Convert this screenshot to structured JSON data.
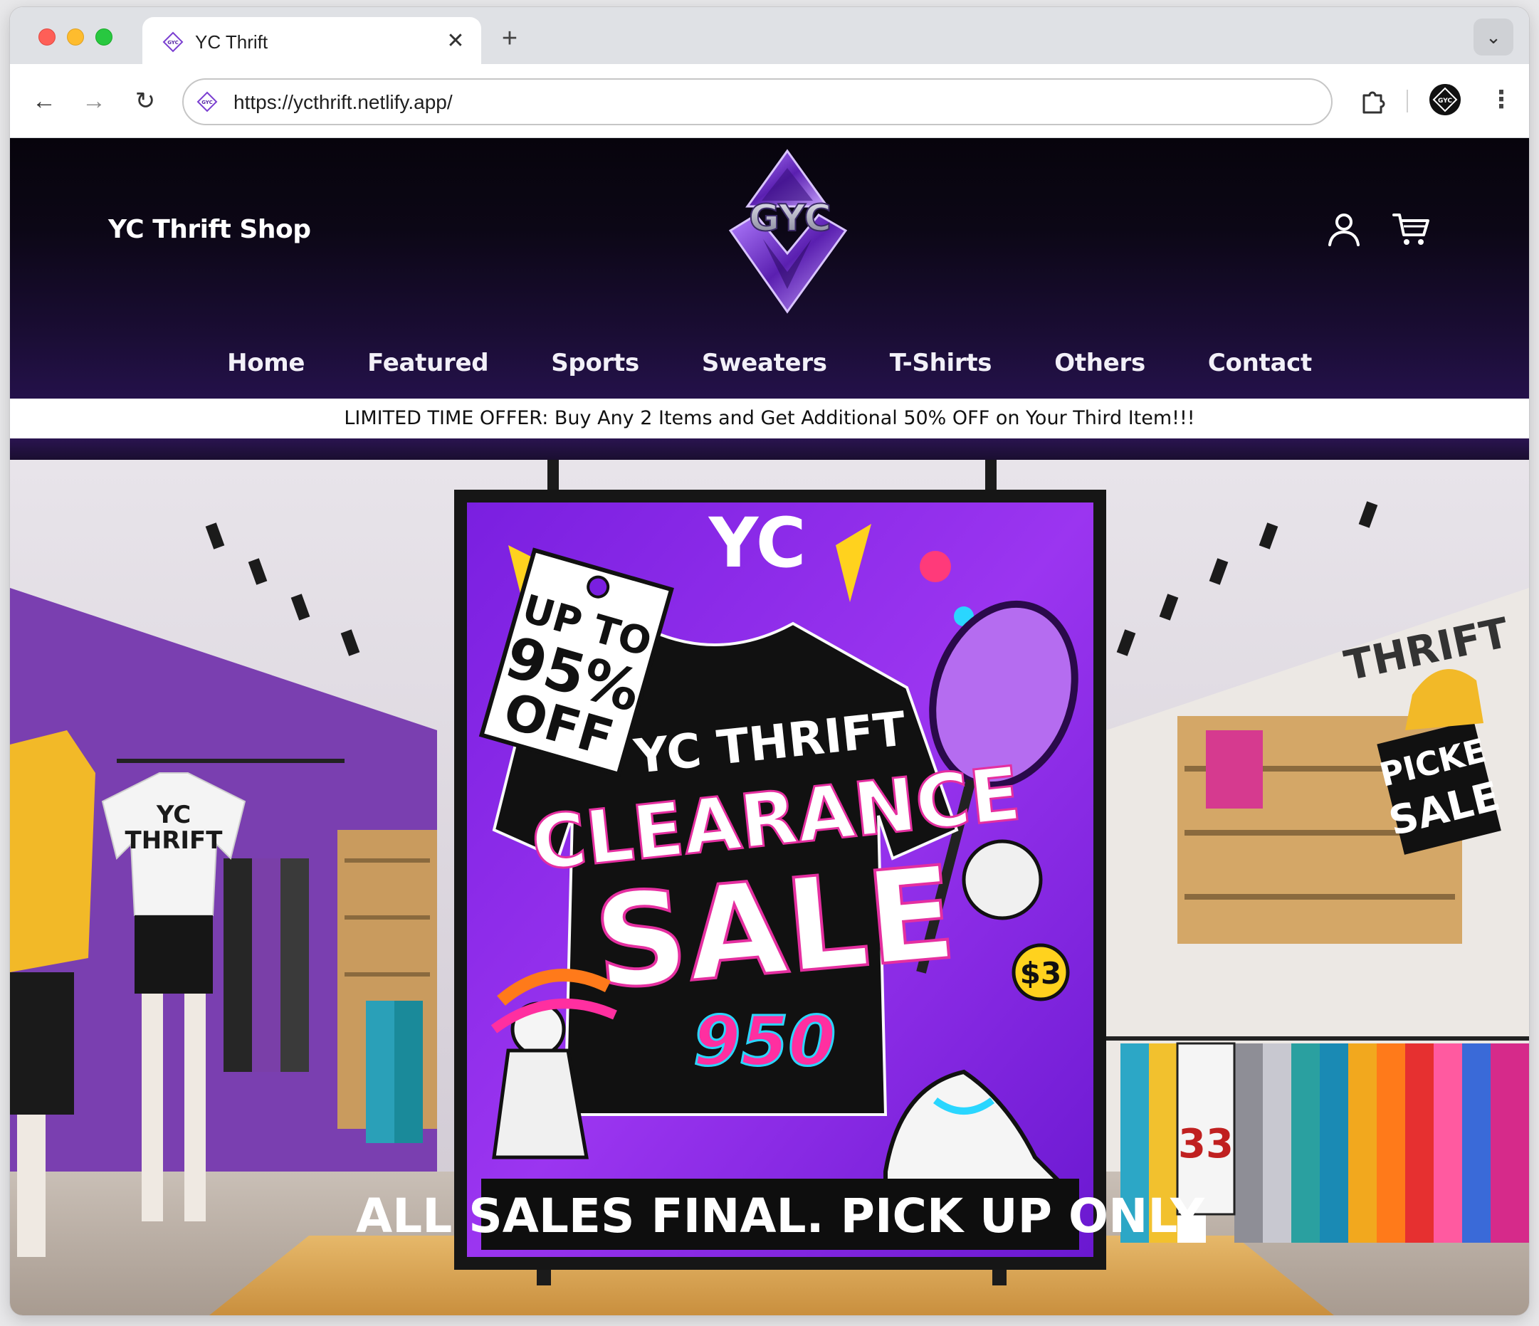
{
  "browser": {
    "tab_title": "YC Thrift",
    "tab_close": "✕",
    "new_tab": "+",
    "url": "https://ycthrift.netlify.app/"
  },
  "site": {
    "shop_name": "YC Thrift Shop",
    "logo_text": "GYC",
    "nav": [
      "Home",
      "Featured",
      "Sports",
      "Sweaters",
      "T-Shirts",
      "Others",
      "Contact"
    ],
    "promo": "LIMITED TIME OFFER: Buy Any 2 Items and Get Additional 50% OFF on Your Third Item!!!"
  },
  "hero": {
    "poster_brand": "YC",
    "tag_text": [
      "UP TO",
      "95%",
      "OFF"
    ],
    "shirt_line1": "YC THRIFT",
    "shirt_line2": "CLEARANCE",
    "shirt_line3": "SALE",
    "footer": "ALL SALES FINAL. PICK UP ONLY",
    "left_shirt": [
      "YC",
      "THRIFT"
    ],
    "right_wall": "THRIFT",
    "right_sign": [
      "PICKE",
      "SALE"
    ],
    "jersey_number": "33",
    "badge": "$3",
    "graffiti": "950"
  },
  "colors": {
    "header_dark": "#0c0716",
    "header_purple": "#24114a",
    "poster_purple": "#8a2be2",
    "accent_pink": "#ff2fa0"
  }
}
